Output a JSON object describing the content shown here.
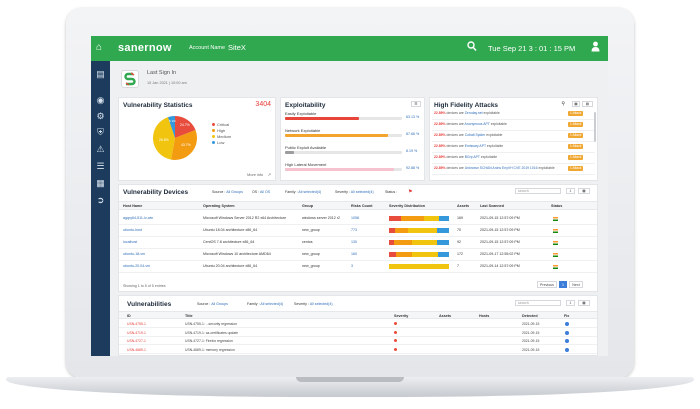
{
  "topbar": {
    "logo": "sanernow",
    "account_label": "Account Name",
    "account_name": "SiteX",
    "datetime": "Tue Sep 21  3 : 01 : 15 PM"
  },
  "sign_in": {
    "label": "Last Sign In",
    "value": "15 Jan 2021 | 10:00 am"
  },
  "vuln_stats": {
    "title": "Vulnerability Statistics",
    "total": "3404",
    "more_info": "More info",
    "legend": [
      {
        "label": "Critical",
        "color": "#e74c3c"
      },
      {
        "label": "High",
        "color": "#f39c12"
      },
      {
        "label": "Medium",
        "color": "#f1c40f"
      },
      {
        "label": "Low",
        "color": "#3498db"
      }
    ],
    "slice_labels": [
      "24.7%",
      "43.7%",
      "26.5%",
      "5.1%"
    ]
  },
  "exploitability": {
    "title": "Exploitability",
    "items": [
      {
        "label": "Easily Exploitable",
        "pct": "63.13 %",
        "value": 0.63,
        "color": "#e7453a"
      },
      {
        "label": "Network Exploitable",
        "pct": "87.66 %",
        "value": 0.88,
        "color": "#f2a42c"
      },
      {
        "label": "Public Exploit Available",
        "pct": "8.19 %",
        "value": 0.08,
        "color": "#9a9ca0"
      },
      {
        "label": "High Lateral Movement",
        "pct": "92.88 %",
        "value": 0.93,
        "color": "#f7c2cf"
      }
    ]
  },
  "hfa": {
    "title": "High Fidelity Attacks",
    "rows": [
      {
        "pct": "22.89%",
        "text": "devices are",
        "link": "Zeroday.net",
        "tail": "exploitable",
        "tag": "1 Attack"
      },
      {
        "pct": "22.89%",
        "text": "devices are",
        "link": "Anonymous APT",
        "tail": "exploitable",
        "tag": "1 Attack"
      },
      {
        "pct": "22.89%",
        "text": "devices are",
        "link": "Cobalt Spider",
        "tail": "exploitable",
        "tag": "1 Attack"
      },
      {
        "pct": "22.89%",
        "text": "devices are",
        "link": "Emissary APT",
        "tail": "exploitable",
        "tag": "1 Attack"
      },
      {
        "pct": "22.89%",
        "text": "devices are",
        "link": "BGrp APT",
        "tail": "exploitable",
        "tag": "1 Attack"
      },
      {
        "pct": "22.89%",
        "text": "devices are",
        "link": "Unknown SCHAN Archs EnyVH CVE 2019 1016",
        "tail": "exploitable",
        "tag": "1 Attack"
      }
    ]
  },
  "devices": {
    "title": "Vulnerability Devices",
    "filters": [
      {
        "label": "Source :",
        "value": "All Groups"
      },
      {
        "label": "OS :",
        "value": "All OS"
      },
      {
        "label": "Family :",
        "value": "All selected(4)"
      },
      {
        "label": "Severity :",
        "value": "All selected(4)"
      },
      {
        "label": "Status :",
        "value": ""
      }
    ],
    "search_placeholder": "search",
    "columns": [
      "Host Name",
      "Operating System",
      "Group",
      "Risks Count",
      "Severity Distribution",
      "Assets",
      "Last Scanned",
      "Status"
    ],
    "rows": [
      {
        "host": "agqry64-511-lv-win",
        "os": "Microsoft Windows Server 2012 R2 x64 Architecture",
        "group": "windows server 2012 r2",
        "risks": "1058",
        "sev": [
          20,
          38,
          26,
          16
        ],
        "assets": "169",
        "scanned": "2021-09-15 12:57:09 PM"
      },
      {
        "host": "ubuntu-host",
        "os": "Ubuntu 18.04 architecture x86_64",
        "group": "new_group",
        "risks": "773",
        "sev": [
          10,
          22,
          48,
          20
        ],
        "assets": "70",
        "scanned": "2021-09-15 12:57:09 PM"
      },
      {
        "host": "localhost",
        "os": "CentOS 7.8 architecture x86_64",
        "group": "centos",
        "risks": "130",
        "sev": [
          8,
          30,
          42,
          20
        ],
        "assets": "92",
        "scanned": "2021-09-15 12:57:09 PM"
      },
      {
        "host": "ubuntu-18-vm",
        "os": "Microsoft Windows 10 architecture AMD64",
        "group": "new_group",
        "risks": "160",
        "sev": [
          12,
          26,
          44,
          18
        ],
        "assets": "172",
        "scanned": "2021-09-17 12:55:02 PM"
      },
      {
        "host": "ubuntu-20.04-vm",
        "os": "Ubuntu 20.04 architecture x86_64",
        "group": "new_group",
        "risks": "3",
        "sev": [
          0,
          0,
          100,
          0
        ],
        "assets": "7",
        "scanned": "2021-09-14 12:57:09 PM"
      }
    ],
    "footer": "Showing 1 to 5 of 5 entries",
    "prev": "Previous",
    "page": "1",
    "next": "Next"
  },
  "vulns": {
    "title": "Vulnerabilities",
    "filters": [
      {
        "label": "Source :",
        "value": "All Groups"
      },
      {
        "label": "Family :",
        "value": "All selected(4)"
      },
      {
        "label": "Severity :",
        "value": "All selected(4)"
      }
    ],
    "search_placeholder": "search",
    "columns": [
      "ID",
      "Title",
      "Severity",
      "Assets",
      "Hosts",
      "Detected",
      "Fix"
    ],
    "rows": [
      {
        "id": "USN-4755-1",
        "title": "USN-4755-1: ...security regression",
        "date": "2021-09-15"
      },
      {
        "id": "USN-4719-1",
        "title": "USN-4719-1: ca-certificates update",
        "date": "2021-09-15"
      },
      {
        "id": "USN-4727-1",
        "title": "USN-4727-1: Firefox regression",
        "date": "2021-09-15"
      },
      {
        "id": "USN-4689-1",
        "title": "USN-4689-1: memory regression",
        "date": "2021-09-15"
      }
    ]
  }
}
